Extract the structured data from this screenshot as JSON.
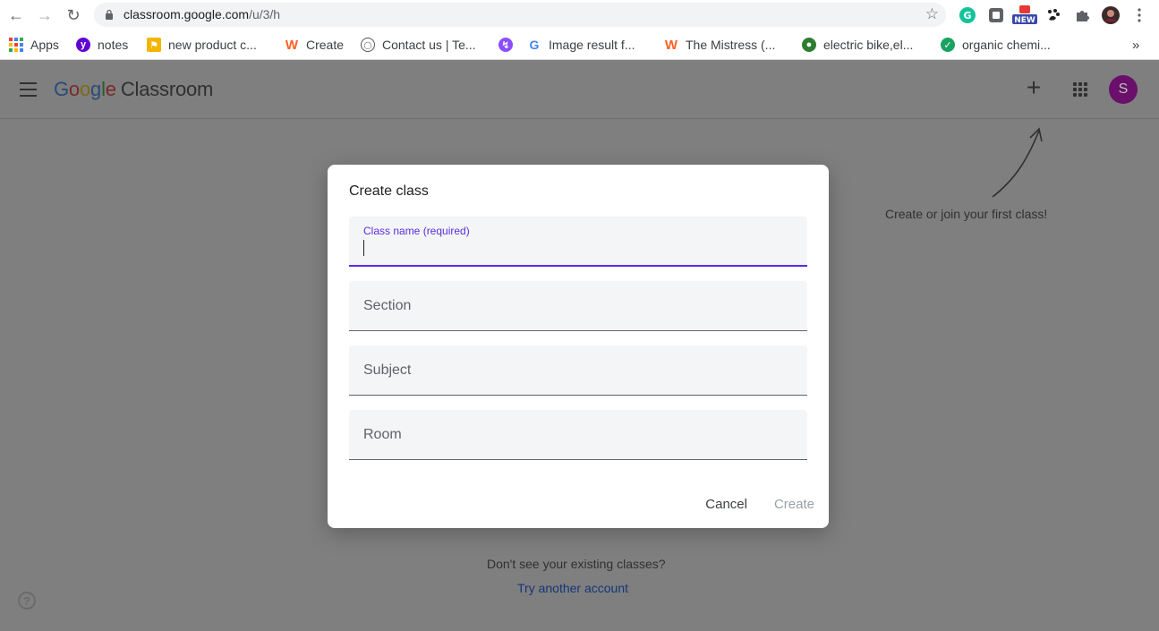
{
  "browser": {
    "url_host": "classroom.google.com",
    "url_path": "/u/3/h",
    "extension_badge": "NEW"
  },
  "bookmarks": [
    {
      "label": "Apps",
      "icon": "apps-grid-icon"
    },
    {
      "label": "notes",
      "icon": "yahoo-icon",
      "color": "#6001d2"
    },
    {
      "label": "new product c...",
      "icon": "flag-icon",
      "color": "#f4b400"
    },
    {
      "label": "Create",
      "icon": "wattpad-icon",
      "color": "#ff6122"
    },
    {
      "label": "Contact us | Te...",
      "icon": "toyota-icon",
      "color": "#555555"
    },
    {
      "label": "",
      "icon": "messenger-icon",
      "color": "#8a4dff"
    },
    {
      "label": "Image result f...",
      "icon": "google-icon",
      "color": "#4285f4"
    },
    {
      "label": "The Mistress (...",
      "icon": "wattpad-icon",
      "color": "#ff6122"
    },
    {
      "label": "electric bike,el...",
      "icon": "globe-icon",
      "color": "#2e7d32"
    },
    {
      "label": "organic chemi...",
      "icon": "shield-check-icon",
      "color": "#1aa260"
    }
  ],
  "app": {
    "logo_google": [
      "G",
      "o",
      "o",
      "g",
      "l",
      "e"
    ],
    "logo_product": "Classroom",
    "avatar_letter": "S",
    "hint": "Create or join your first class!",
    "bottom_question": "Don't see your existing classes?",
    "bottom_link": "Try another account",
    "help_symbol": "?"
  },
  "dialog": {
    "title": "Create class",
    "fields": [
      {
        "label": "Class name (required)",
        "value": "",
        "active": true
      },
      {
        "label": "Section",
        "value": ""
      },
      {
        "label": "Subject",
        "value": ""
      },
      {
        "label": "Room",
        "value": ""
      }
    ],
    "cancel_label": "Cancel",
    "create_label": "Create"
  },
  "colors": {
    "accent": "#5b2de0",
    "avatar": "#6a0f6a",
    "overlay": "#7f7f7f"
  }
}
